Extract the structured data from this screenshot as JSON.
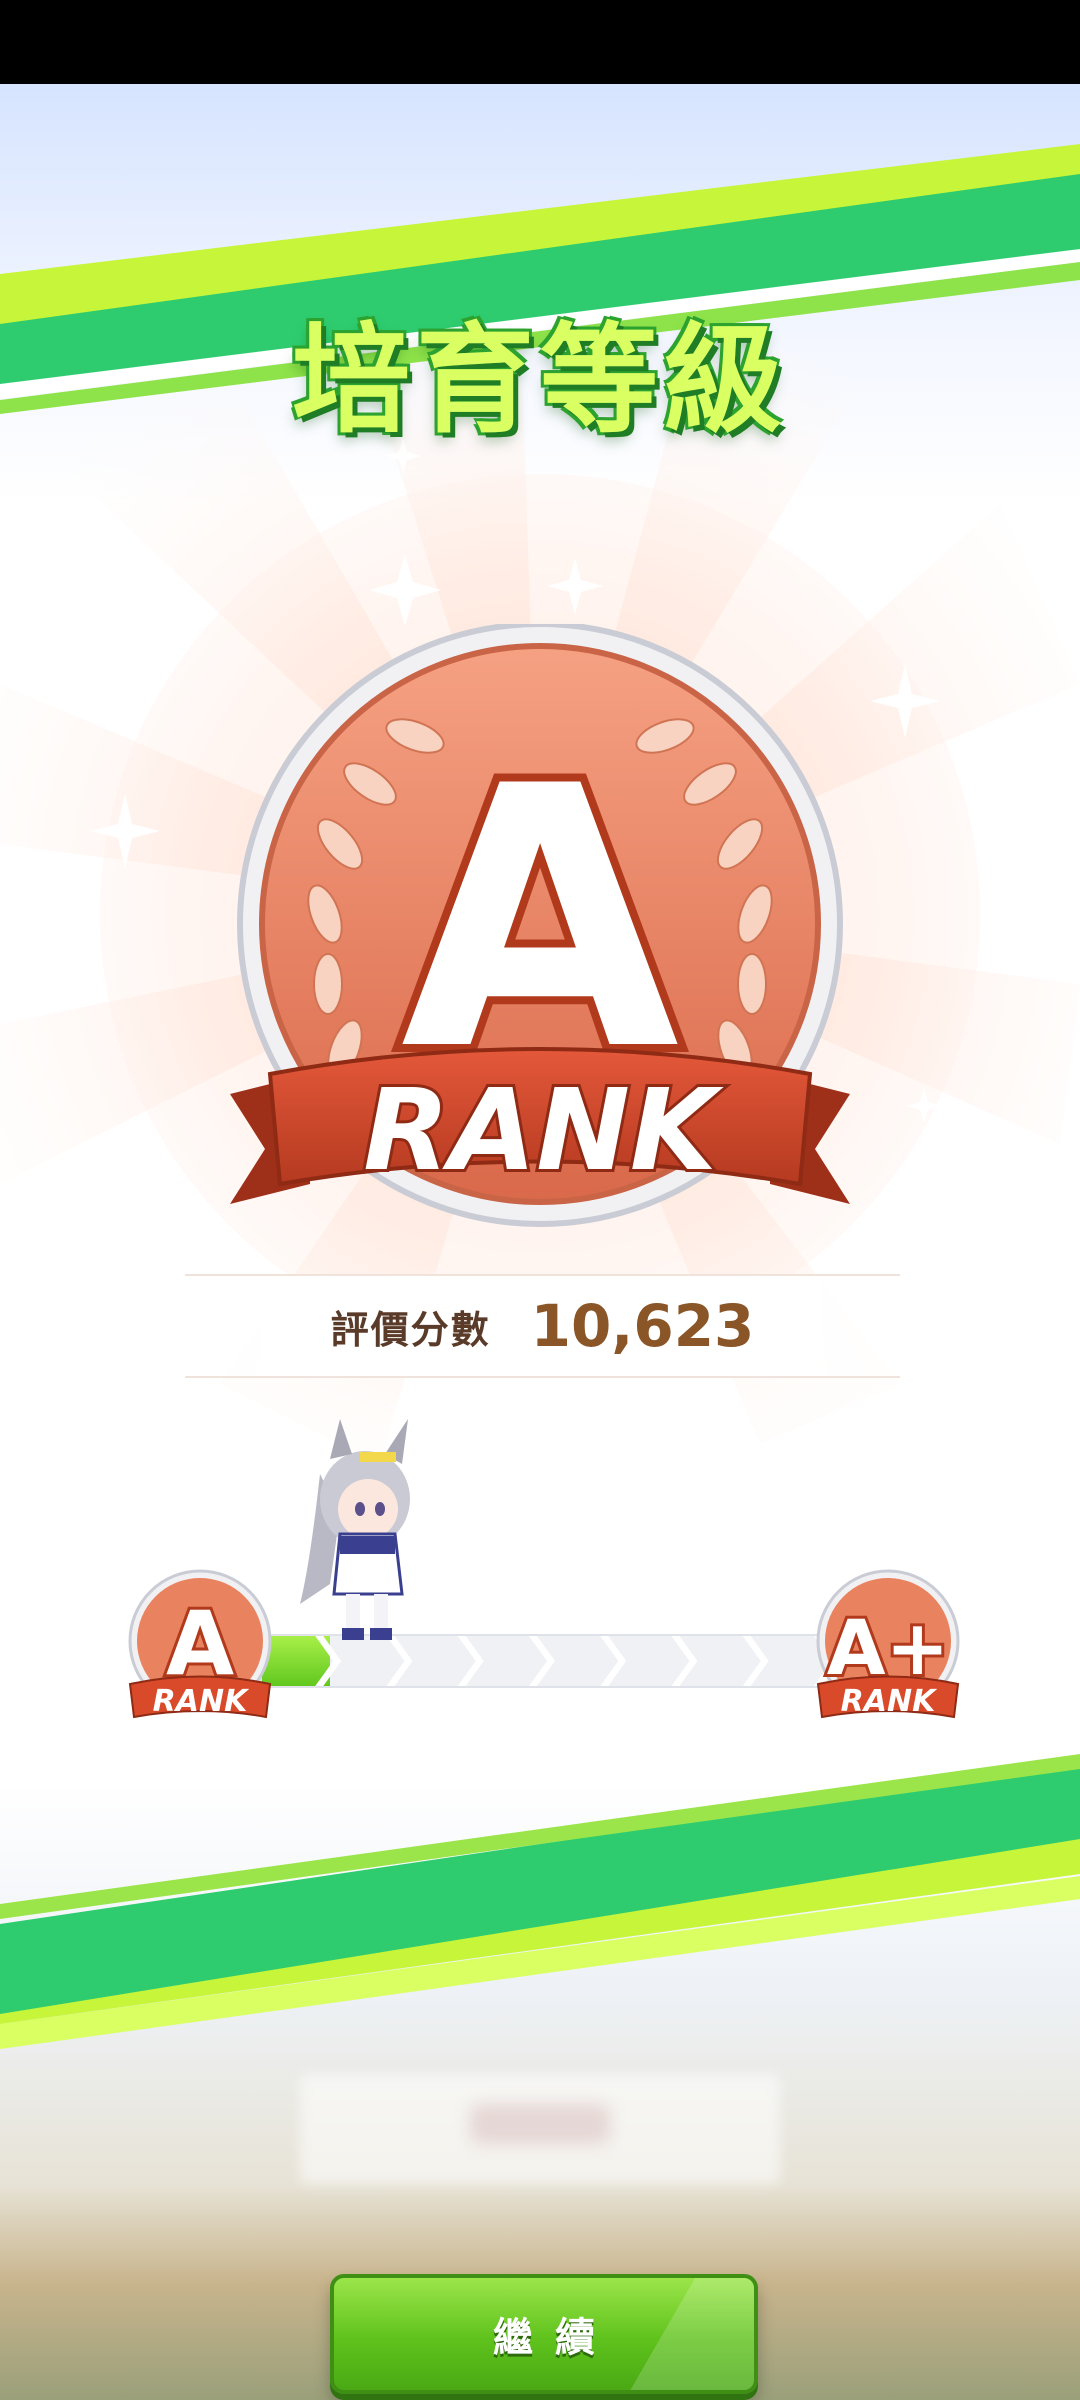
{
  "screen": {
    "title": "培育等級",
    "rank": {
      "letter": "A",
      "word": "RANK",
      "medal_color": "#e9825f",
      "ribbon_color": "#d94a2a"
    },
    "score": {
      "label": "評價分數",
      "value": "10,623"
    },
    "progress": {
      "current_rank": {
        "letter": "A",
        "word": "RANK"
      },
      "next_rank": {
        "letter": "A+",
        "word": "RANK"
      },
      "fraction": 0.12,
      "steps": 8
    },
    "continue_button": {
      "label": "繼續"
    },
    "colors": {
      "accent_green": "#5fc21c",
      "stripe_green": "#2ecc6f",
      "stripe_lime": "#c6f53a",
      "score_value": "#8a5527"
    }
  }
}
